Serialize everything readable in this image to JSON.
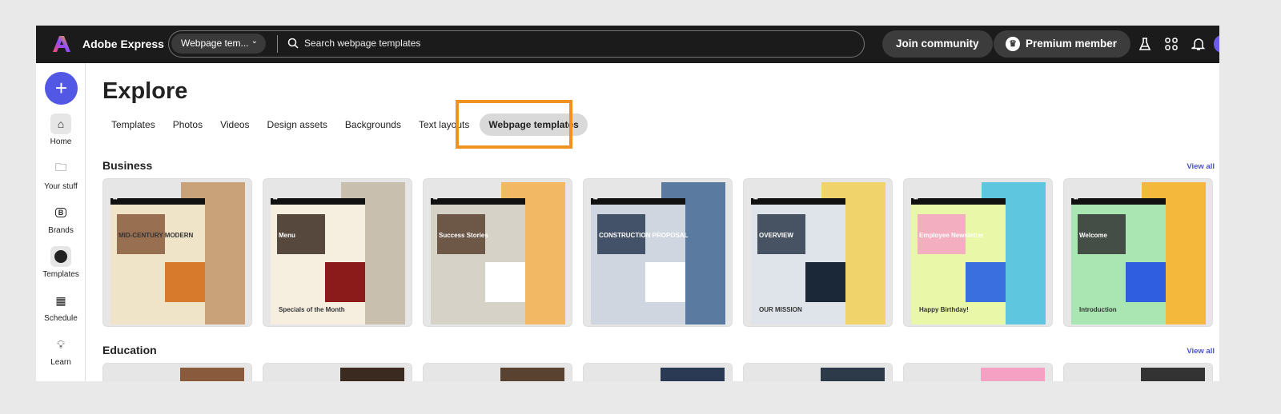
{
  "header": {
    "brand": "Adobe Express",
    "search_scope": "Webpage tem...",
    "search_placeholder": "Search webpage templates",
    "join": "Join community",
    "premium": "Premium member",
    "icons": [
      "flask-icon",
      "apps-icon",
      "bell-icon"
    ]
  },
  "sidebar": {
    "create_label": "+",
    "items": [
      {
        "label": "Home",
        "icon": "home-icon"
      },
      {
        "label": "Your stuff",
        "icon": "folder-icon"
      },
      {
        "label": "Brands",
        "icon": "brand-icon"
      },
      {
        "label": "Templates",
        "icon": "templates-icon"
      },
      {
        "label": "Schedule",
        "icon": "calendar-icon"
      },
      {
        "label": "Learn",
        "icon": "lightbulb-icon"
      }
    ]
  },
  "main": {
    "title": "Explore",
    "tabs": [
      "Templates",
      "Photos",
      "Videos",
      "Design assets",
      "Backgrounds",
      "Text layouts",
      "Webpage templates"
    ],
    "selected_tab": "Webpage templates",
    "highlight_color": "#f0921f",
    "sections": [
      {
        "title": "Business",
        "view_all": "View all"
      },
      {
        "title": "Education",
        "view_all": "View all"
      }
    ],
    "business_cards": [
      {
        "label": "MID-CENTURY MODERN"
      },
      {
        "label": "Menu",
        "sub": "Specials of the Month"
      },
      {
        "label": "Success Stories"
      },
      {
        "label": "CONSTRUCTION PROPOSAL"
      },
      {
        "label": "OVERVIEW",
        "sub": "OUR MISSION"
      },
      {
        "label": "Employee Newsletter",
        "sub": "Happy Birthday!"
      },
      {
        "label": "Welcome",
        "sub": "Introduction"
      }
    ]
  },
  "colors": {
    "accent": "#5258e4",
    "topbar": "#1b1b1b",
    "link": "#4a4fd6"
  }
}
